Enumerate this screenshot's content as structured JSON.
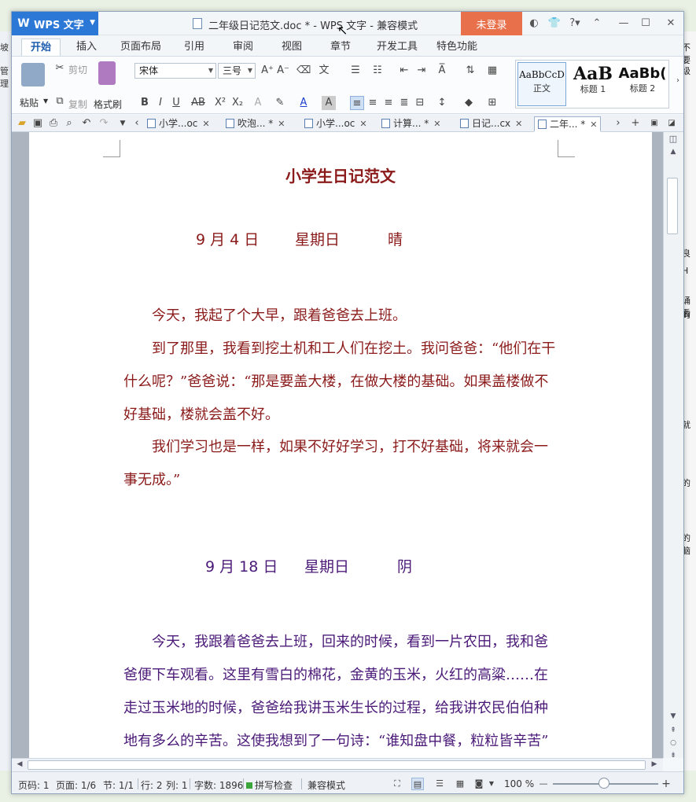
{
  "app": {
    "name": "WPS 文字",
    "logo": "W",
    "window_title": "二年级日记范文.doc * - WPS 文字 - 兼容模式",
    "login_label": "未登录"
  },
  "background": {
    "right_texts": [
      "不要",
      "级",
      "良",
      "H",
      "诵看",
      "的",
      "就",
      "的",
      "的脑"
    ],
    "left_texts": [
      "坡",
      "管理"
    ]
  },
  "tabs": [
    "开始",
    "插入",
    "页面布局",
    "引用",
    "审阅",
    "视图",
    "章节",
    "开发工具",
    "特色功能"
  ],
  "ribbon": {
    "paste": "粘贴",
    "cut": "剪切",
    "copy": "复制",
    "format_painter": "格式刷",
    "font_name": "宋体",
    "font_size": "三号",
    "styles": [
      {
        "preview": "AaBbCcD",
        "name": "正文"
      },
      {
        "preview": "AaB",
        "name": "标题 1"
      },
      {
        "preview": "AaBb(",
        "name": "标题 2"
      }
    ]
  },
  "doc_tabs": [
    {
      "label": "小学...oc",
      "active": false
    },
    {
      "label": "吹泡... *",
      "active": false
    },
    {
      "label": "小学...oc",
      "active": false
    },
    {
      "label": "计算... *",
      "active": false
    },
    {
      "label": "日记...cx",
      "active": false
    },
    {
      "label": "二年... *",
      "active": true
    }
  ],
  "document": {
    "title": "小学生日记范文",
    "entry1": {
      "date": "9 月 4 日",
      "weekday": "星期日",
      "weather": "晴",
      "paragraphs": [
        "今天，我起了个大早，跟着爸爸去上班。",
        "到了那里，我看到挖土机和工人们在挖土。我问爸爸：“他们在干什么呢？”爸爸说：“那是要盖大楼，在做大楼的基础。如果盖楼做不好基础，楼就会盖不好。",
        "我们学习也是一样，如果不好好学习，打不好基础，将来就会一事无成。”"
      ]
    },
    "entry2": {
      "date": "9 月 18 日",
      "weekday": "星期日",
      "weather": "阴",
      "paragraphs": [
        "今天，我跟着爸爸去上班，回来的时候，看到一片农田，我和爸爸便下车观看。这里有雪白的棉花，金黄的玉米，火红的高粱……在走过玉米地的时候，爸爸给我讲玉米生长的过程，给我讲农民伯伯种地有多么的辛苦。这使我想到了一句诗：“谁知盘中餐，粒粒皆辛苦”"
      ]
    }
  },
  "status": {
    "page_num": "页码: 1",
    "pages": "页面: 1/6",
    "section": "节: 1/1",
    "row": "行: 2",
    "col": "列: 1",
    "word_count": "字数: 1896",
    "spell_check": "拼写检查",
    "compat_mode": "兼容模式",
    "zoom": "100 %",
    "zoom_level": 0.5
  },
  "colors": {
    "app_blue": "#2b78d6",
    "login_orange": "#e8704b",
    "text_red": "#8b1a1a",
    "text_purple": "#4b1a78"
  }
}
